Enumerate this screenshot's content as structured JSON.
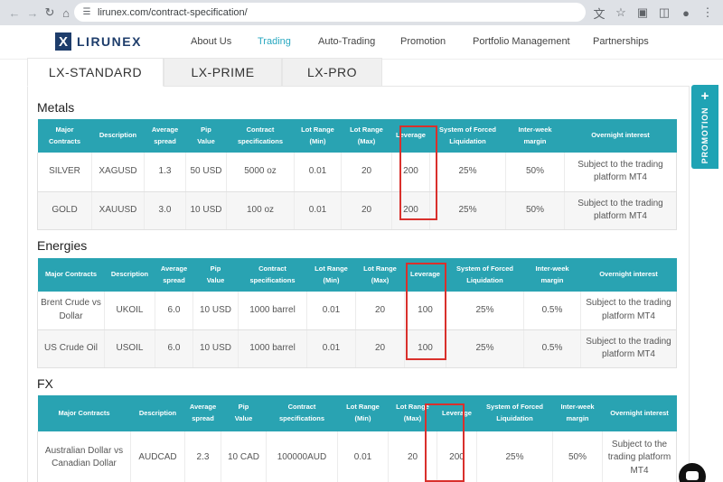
{
  "browser": {
    "url": "lirunex.com/contract-specification/"
  },
  "header": {
    "logo_text": "LIRUNEX",
    "logo_mark": "X",
    "nav": [
      "About Us",
      "Trading",
      "Auto-Trading",
      "Promotion",
      "Portfolio Management",
      "Partnerships"
    ],
    "active_nav": "Trading",
    "accent_color": "#29a8c0"
  },
  "tabs": [
    "LX-STANDARD",
    "LX-PRIME",
    "LX-PRO"
  ],
  "active_tab": "LX-STANDARD",
  "sections": {
    "metals": {
      "title": "Metals",
      "headers": [
        "Major\nContracts",
        "Description",
        "Average\nspread",
        "Pip\nValue",
        "Contract\nspecifications",
        "Lot Range\n(Min)",
        "Lot Range\n(Max)",
        "Leverage",
        "System of Forced\nLiquidation",
        "Inter-week\nmargin",
        "Overnight interest"
      ],
      "rows": [
        [
          "SILVER",
          "XAGUSD",
          "1.3",
          "50 USD",
          "5000 oz",
          "0.01",
          "20",
          "200",
          "25%",
          "50%",
          "Subject to the trading platform MT4"
        ],
        [
          "GOLD",
          "XAUUSD",
          "3.0",
          "10 USD",
          "100 oz",
          "0.01",
          "20",
          "200",
          "25%",
          "50%",
          "Subject to the trading platform MT4"
        ]
      ]
    },
    "energies": {
      "title": "Energies",
      "headers": [
        "Major Contracts",
        "Description",
        "Average\nspread",
        "Pip\nValue",
        "Contract\nspecifications",
        "Lot Range\n(Min)",
        "Lot Range\n(Max)",
        "Leverage",
        "System of Forced\nLiquidation",
        "Inter-week\nmargin",
        "Overnight interest"
      ],
      "rows": [
        [
          "Brent Crude vs Dollar",
          "UKOIL",
          "6.0",
          "10 USD",
          "1000 barrel",
          "0.01",
          "20",
          "100",
          "25%",
          "0.5%",
          "Subject to the trading platform MT4"
        ],
        [
          "US Crude Oil",
          "USOIL",
          "6.0",
          "10 USD",
          "1000 barrel",
          "0.01",
          "20",
          "100",
          "25%",
          "0.5%",
          "Subject to the trading platform MT4"
        ]
      ]
    },
    "fx": {
      "title": "FX",
      "headers": [
        "Major Contracts",
        "Description",
        "Average\nspread",
        "Pip\nValue",
        "Contract\nspecifications",
        "Lot Range\n(Min)",
        "Lot Range\n(Max)",
        "Leverage",
        "System of Forced\nLiquidation",
        "Inter-week\nmargin",
        "Overnight interest"
      ],
      "rows": [
        [
          "Australian Dollar vs Canadian Dollar",
          "AUDCAD",
          "2.3",
          "10 CAD",
          "100000AUD",
          "0.01",
          "20",
          "200",
          "25%",
          "50%",
          "Subject to the trading platform MT4"
        ]
      ]
    }
  },
  "promotion": {
    "label": "PROMOTION",
    "plus": "+",
    "color": "#1fa3b4"
  },
  "highlight_color": "#d9302c",
  "table_header_color": "#29a3b2"
}
